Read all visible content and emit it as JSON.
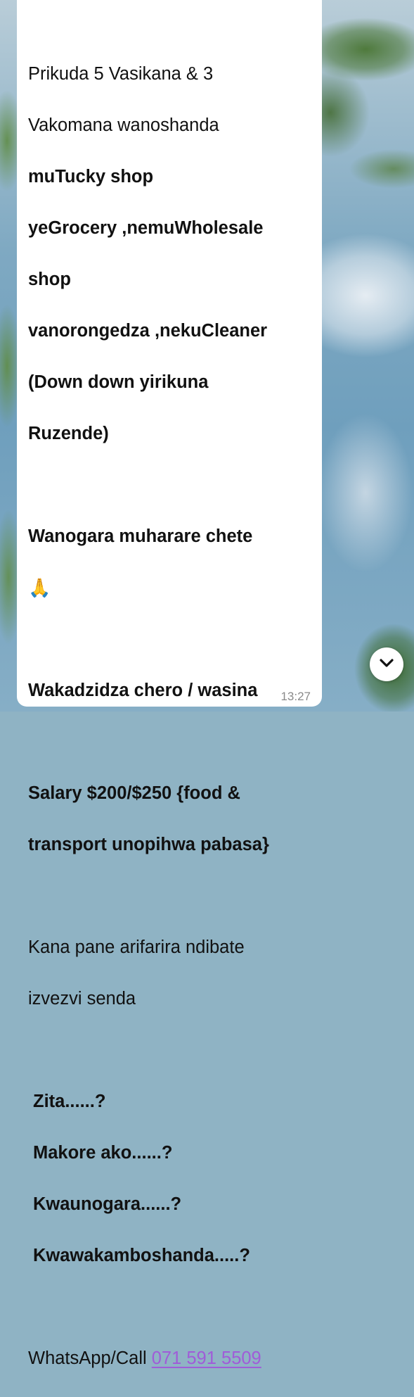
{
  "header_fragment": "",
  "message": {
    "lines": [
      {
        "text": "Prikuda 5 Vasikana & 3",
        "bold": false
      },
      {
        "text": "Vakomana wanoshanda",
        "bold": false
      },
      {
        "text": "muTucky shop",
        "bold": true
      },
      {
        "text": "yeGrocery ,nemuWholesale",
        "bold": true
      },
      {
        "text": "shop",
        "bold": true
      },
      {
        "text": "vanorongedza ,nekuCleaner",
        "bold": true
      },
      {
        "text": "(Down down yirikuna",
        "bold": true
      },
      {
        "text": "Ruzende)",
        "bold": true
      },
      {
        "text": "Wanogara muharare chete",
        "bold": true
      },
      {
        "text": "🙏",
        "bold": false
      },
      {
        "text": "Wakadzidza chero / wasina",
        "bold": true
      },
      {
        "text": "Salary $200/$250 {food &",
        "bold": true
      },
      {
        "text": "transport unopihwa pabasa}",
        "bold": true
      },
      {
        "text": "Kana pane arifarira ndibate",
        "bold": false
      },
      {
        "text": "izvezvi senda",
        "bold": false
      },
      {
        "text": "Zita......?",
        "bold": true
      },
      {
        "text": "Makore ako......?",
        "bold": true
      },
      {
        "text": "Kwaunogara......?",
        "bold": true
      },
      {
        "text": "Kwawakamboshanda.....?",
        "bold": true
      }
    ],
    "contact_label": "WhatsApp/Call ",
    "phone_number": "071 591 5509",
    "time": "13:27"
  },
  "colors": {
    "link": "#a05cd8",
    "bubble": "#ffffff",
    "timestamp": "#8a8a8a"
  },
  "icons": {
    "scroll_down": "chevron-down-icon"
  }
}
